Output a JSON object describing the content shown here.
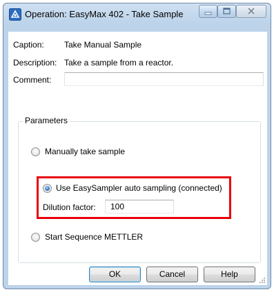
{
  "window": {
    "title": "Operation: EasyMax 402 - Take Sample"
  },
  "caption": {
    "label": "Caption:",
    "value": "Take Manual Sample"
  },
  "description": {
    "label": "Description:",
    "value": "Take a sample from a reactor."
  },
  "comment": {
    "label": "Comment:",
    "value": ""
  },
  "parameters": {
    "title": "Parameters",
    "options": [
      {
        "label": "Manually take sample",
        "selected": false
      },
      {
        "label": "Use EasySampler auto sampling (connected)",
        "selected": true
      },
      {
        "label": "Start Sequence METTLER",
        "selected": false
      }
    ],
    "dilution": {
      "label": "Dilution factor:",
      "value": "100"
    }
  },
  "buttons": {
    "ok": "OK",
    "cancel": "Cancel",
    "help": "Help"
  },
  "colors": {
    "highlight": "#e8000b",
    "titlebar": "#bcd3ea"
  },
  "icons": [
    "app-icon",
    "minimize-icon",
    "maximize-icon",
    "close-icon",
    "resize-grip-icon"
  ]
}
